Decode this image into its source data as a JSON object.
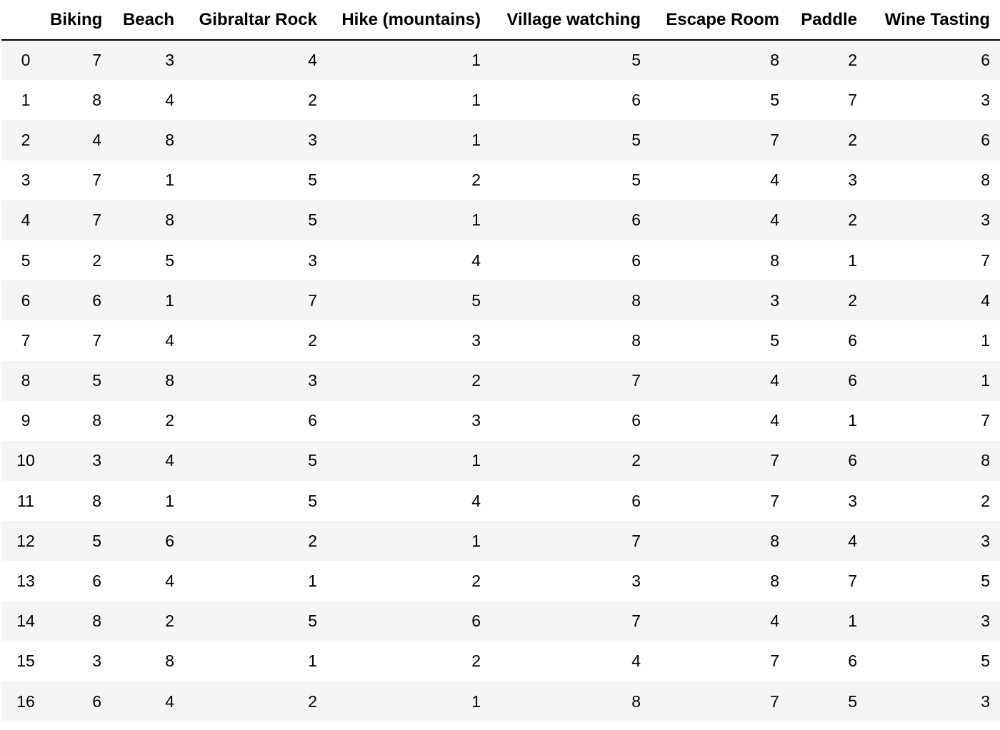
{
  "table": {
    "columns": [
      "",
      "Biking",
      "Beach",
      "Gibraltar Rock",
      "Hike (mountains)",
      "Village watching",
      "Escape Room",
      "Paddle",
      "Wine Tasting"
    ],
    "rows": [
      {
        "index": "0",
        "values": [
          "7",
          "3",
          "4",
          "1",
          "5",
          "8",
          "2",
          "6"
        ]
      },
      {
        "index": "1",
        "values": [
          "8",
          "4",
          "2",
          "1",
          "6",
          "5",
          "7",
          "3"
        ]
      },
      {
        "index": "2",
        "values": [
          "4",
          "8",
          "3",
          "1",
          "5",
          "7",
          "2",
          "6"
        ]
      },
      {
        "index": "3",
        "values": [
          "7",
          "1",
          "5",
          "2",
          "5",
          "4",
          "3",
          "8"
        ]
      },
      {
        "index": "4",
        "values": [
          "7",
          "8",
          "5",
          "1",
          "6",
          "4",
          "2",
          "3"
        ]
      },
      {
        "index": "5",
        "values": [
          "2",
          "5",
          "3",
          "4",
          "6",
          "8",
          "1",
          "7"
        ]
      },
      {
        "index": "6",
        "values": [
          "6",
          "1",
          "7",
          "5",
          "8",
          "3",
          "2",
          "4"
        ]
      },
      {
        "index": "7",
        "values": [
          "7",
          "4",
          "2",
          "3",
          "8",
          "5",
          "6",
          "1"
        ]
      },
      {
        "index": "8",
        "values": [
          "5",
          "8",
          "3",
          "2",
          "7",
          "4",
          "6",
          "1"
        ]
      },
      {
        "index": "9",
        "values": [
          "8",
          "2",
          "6",
          "3",
          "6",
          "4",
          "1",
          "7"
        ]
      },
      {
        "index": "10",
        "values": [
          "3",
          "4",
          "5",
          "1",
          "2",
          "7",
          "6",
          "8"
        ]
      },
      {
        "index": "11",
        "values": [
          "8",
          "1",
          "5",
          "4",
          "6",
          "7",
          "3",
          "2"
        ]
      },
      {
        "index": "12",
        "values": [
          "5",
          "6",
          "2",
          "1",
          "7",
          "8",
          "4",
          "3"
        ]
      },
      {
        "index": "13",
        "values": [
          "6",
          "4",
          "1",
          "2",
          "3",
          "8",
          "7",
          "5"
        ]
      },
      {
        "index": "14",
        "values": [
          "8",
          "2",
          "5",
          "6",
          "7",
          "4",
          "1",
          "3"
        ]
      },
      {
        "index": "15",
        "values": [
          "3",
          "8",
          "1",
          "2",
          "4",
          "7",
          "6",
          "5"
        ]
      },
      {
        "index": "16",
        "values": [
          "6",
          "4",
          "2",
          "1",
          "8",
          "7",
          "5",
          "3"
        ]
      }
    ]
  }
}
